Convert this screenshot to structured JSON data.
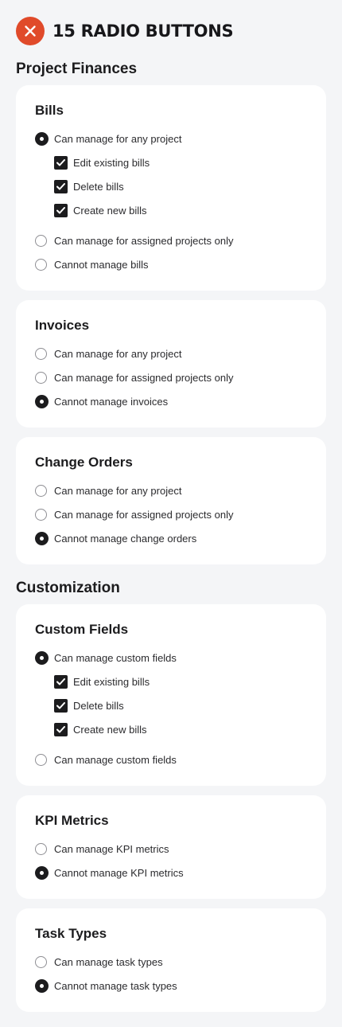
{
  "page": {
    "title": "15 RADIO BUTTONS",
    "icon": "close-circle-icon",
    "accent_color": "#e04a2a"
  },
  "sections": [
    {
      "heading": "Project Finances",
      "cards": [
        {
          "title": "Bills",
          "options": [
            {
              "label": "Can manage for any project",
              "checked": true
            },
            {
              "label": "Edit existing bills",
              "checkbox": true,
              "checked": true
            },
            {
              "label": "Delete bills",
              "checkbox": true,
              "checked": true
            },
            {
              "label": "Create new bills",
              "checkbox": true,
              "checked": true
            },
            {
              "label": "Can manage for assigned projects only",
              "checked": false
            },
            {
              "label": "Cannot manage bills",
              "checked": false
            }
          ]
        },
        {
          "title": "Invoices",
          "options": [
            {
              "label": "Can manage for any project",
              "checked": false
            },
            {
              "label": "Can manage for assigned projects only",
              "checked": false
            },
            {
              "label": "Cannot manage invoices",
              "checked": true
            }
          ]
        },
        {
          "title": "Change Orders",
          "options": [
            {
              "label": "Can manage for any project",
              "checked": false
            },
            {
              "label": "Can manage for assigned projects only",
              "checked": false
            },
            {
              "label": "Cannot manage change orders",
              "checked": true
            }
          ]
        }
      ]
    },
    {
      "heading": "Customization",
      "cards": [
        {
          "title": "Custom Fields",
          "options": [
            {
              "label": "Can manage custom fields",
              "checked": true
            },
            {
              "label": "Edit existing bills",
              "checkbox": true,
              "checked": true
            },
            {
              "label": "Delete bills",
              "checkbox": true,
              "checked": true
            },
            {
              "label": "Create new bills",
              "checkbox": true,
              "checked": true
            },
            {
              "label": "Can manage custom fields",
              "checked": false
            }
          ]
        },
        {
          "title": "KPI Metrics",
          "options": [
            {
              "label": "Can manage KPI metrics",
              "checked": false
            },
            {
              "label": "Cannot manage KPI metrics",
              "checked": true
            }
          ]
        },
        {
          "title": "Task Types",
          "options": [
            {
              "label": "Can manage task types",
              "checked": false
            },
            {
              "label": "Cannot manage task types",
              "checked": true
            }
          ]
        }
      ]
    }
  ]
}
